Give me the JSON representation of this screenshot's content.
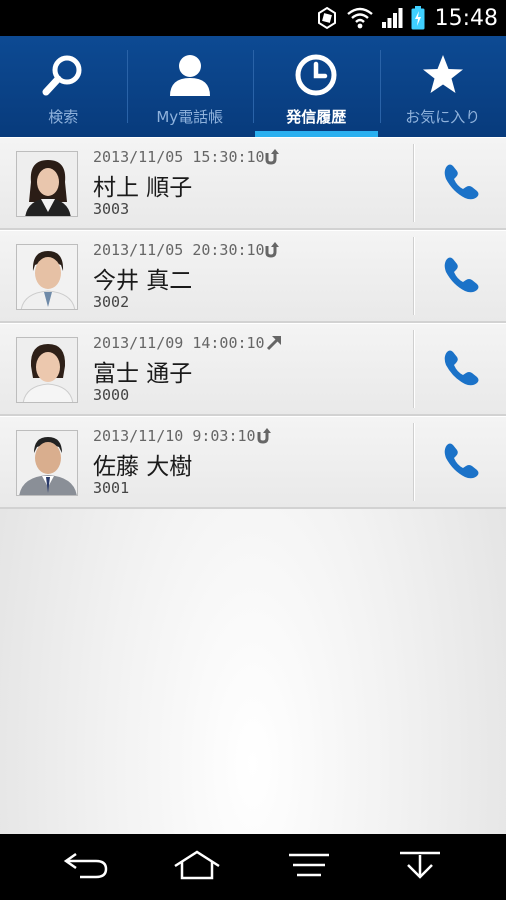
{
  "status_bar": {
    "time": "15:48",
    "icons": [
      "sync-icon",
      "wifi-icon",
      "signal-icon",
      "battery-charging-icon"
    ]
  },
  "tabs": [
    {
      "label": "検索",
      "icon": "search-icon",
      "active": false
    },
    {
      "label": "My電話帳",
      "icon": "contact-icon",
      "active": false
    },
    {
      "label": "発信履歴",
      "icon": "clock-icon",
      "active": true
    },
    {
      "label": "お気に入り",
      "icon": "star-icon",
      "active": false
    }
  ],
  "history": [
    {
      "date": "2013/11/05 15:30:10",
      "direction": "redial-icon",
      "name": "村上 順子",
      "ext": "3003"
    },
    {
      "date": "2013/11/05 20:30:10",
      "direction": "redial-icon",
      "name": "今井 真二",
      "ext": "3002"
    },
    {
      "date": "2013/11/09 14:00:10",
      "direction": "outgoing-arrow-icon",
      "name": "富士 通子",
      "ext": "3000"
    },
    {
      "date": "2013/11/10 9:03:10",
      "direction": "redial-icon",
      "name": "佐藤 大樹",
      "ext": "3001"
    }
  ],
  "colors": {
    "tab_bar": "#0b4489",
    "tab_active_indicator": "#2ab0f0",
    "call_icon": "#1b72c8"
  },
  "nav_bar": [
    "back-icon",
    "home-icon",
    "menu-icon",
    "collapse-icon"
  ]
}
